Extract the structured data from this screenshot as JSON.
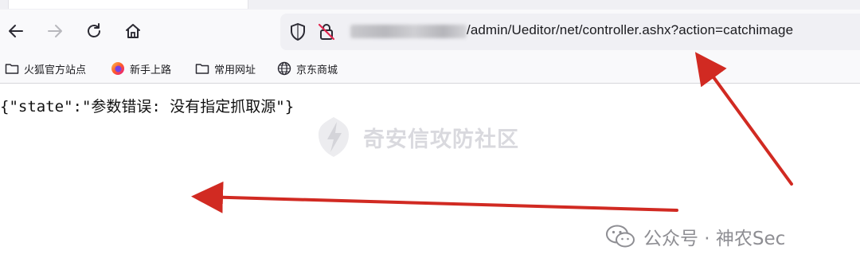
{
  "browser": {
    "address_bar": {
      "url_path": "/admin/Ueditor/net/controller.ashx?action=catchimage"
    },
    "toolbar_icons": [
      "back-arrow-icon",
      "forward-arrow-icon",
      "reload-icon",
      "home-icon",
      "shield-icon",
      "insecure-lock-icon"
    ]
  },
  "bookmarks": [
    {
      "label": "火狐官方站点",
      "icon": "folder-icon"
    },
    {
      "label": "新手上路",
      "icon": "firefox-icon"
    },
    {
      "label": "常用网址",
      "icon": "folder-icon"
    },
    {
      "label": "京东商城",
      "icon": "globe-icon"
    }
  ],
  "content": {
    "json_response": "{\"state\":\"参数错误: 没有指定抓取源\"}"
  },
  "watermark": {
    "text": "奇安信攻防社区"
  },
  "credit": {
    "text": "公众号 · 神农Sec"
  },
  "colors": {
    "arrow": "#d12a22",
    "toolbar_bg": "#f9f9fb",
    "url_bar_bg": "#f0f0f4"
  }
}
